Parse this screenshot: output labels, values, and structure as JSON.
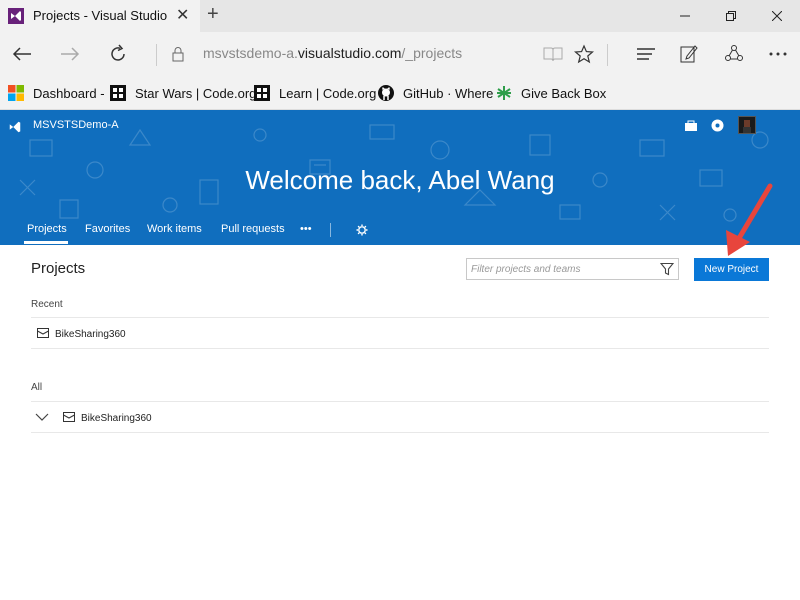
{
  "browser": {
    "tab_title": "Projects - Visual Studio",
    "url_prefix": "msvstsdemo-a.",
    "url_domain": "visualstudio.com",
    "url_path": "/_projects",
    "favorites": [
      {
        "label": "Dashboard -",
        "icon": "windows-logo-icon"
      },
      {
        "label": "Star Wars | Code.org",
        "icon": "code-org-icon"
      },
      {
        "label": "Learn | Code.org",
        "icon": "code-org-icon"
      },
      {
        "label": "GitHub · Where",
        "icon": "github-icon"
      },
      {
        "label": "Give Back Box",
        "icon": "give-back-box-icon"
      }
    ]
  },
  "header": {
    "account": "MSVSTSDemo-A",
    "welcome": "Welcome back, Abel Wang",
    "nav": [
      "Projects",
      "Favorites",
      "Work items",
      "Pull requests",
      "•••"
    ]
  },
  "main": {
    "title": "Projects",
    "filter_placeholder": "Filter projects and teams",
    "new_project": "New Project",
    "recent_label": "Recent",
    "recent": [
      "BikeSharing360"
    ],
    "all_label": "All",
    "all": [
      "BikeSharing360"
    ]
  },
  "colors": {
    "brand_blue": "#106ebe",
    "button_blue": "#0a78d7",
    "arrow_red": "#e8453c"
  }
}
